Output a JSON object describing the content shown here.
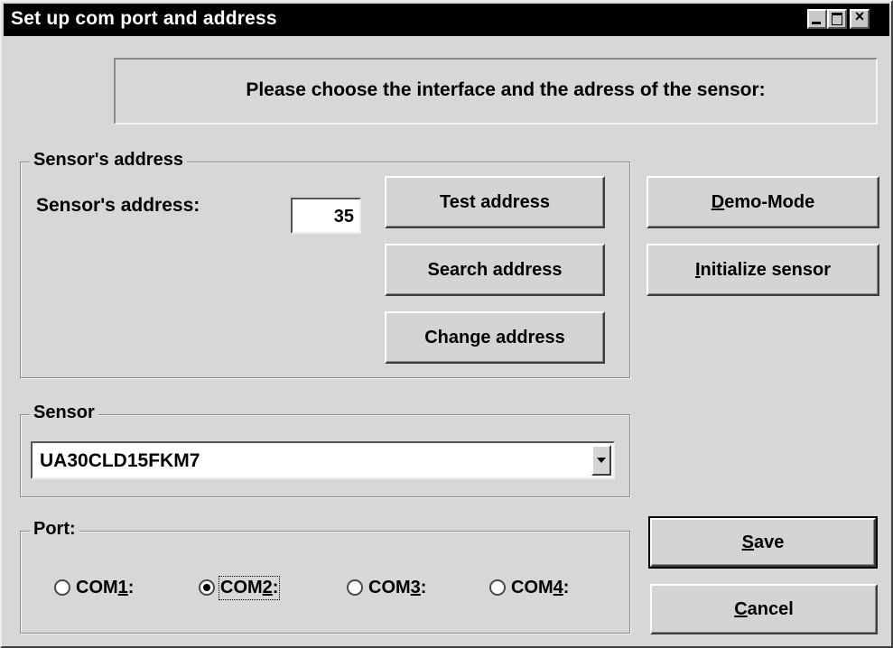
{
  "window": {
    "title": "Set up com port and address"
  },
  "banner": {
    "text": "Please choose the interface and the adress of the sensor:"
  },
  "address_group": {
    "label": "Sensor's address",
    "field_label": "Sensor's address:",
    "value": "35",
    "buttons": {
      "test": "Test address",
      "search": "Search address",
      "change": "Change address"
    }
  },
  "side_buttons": {
    "demo_accel": "D",
    "demo_rest": "emo-Mode",
    "init_accel": "I",
    "init_rest": "nitialize sensor"
  },
  "sensor_group": {
    "label": "Sensor",
    "selected": "UA30CLD15FKM7"
  },
  "port_group": {
    "label": "Port:",
    "options": [
      {
        "prefix": "COM",
        "accel": "1",
        "suffix": ":",
        "checked": false
      },
      {
        "prefix": "COM",
        "accel": "2",
        "suffix": ":",
        "checked": true
      },
      {
        "prefix": "COM",
        "accel": "3",
        "suffix": ":",
        "checked": false
      },
      {
        "prefix": "COM",
        "accel": "4",
        "suffix": ":",
        "checked": false
      }
    ]
  },
  "footer_buttons": {
    "save_accel": "S",
    "save_rest": "ave",
    "cancel_accel": "C",
    "cancel_rest": "ancel"
  }
}
